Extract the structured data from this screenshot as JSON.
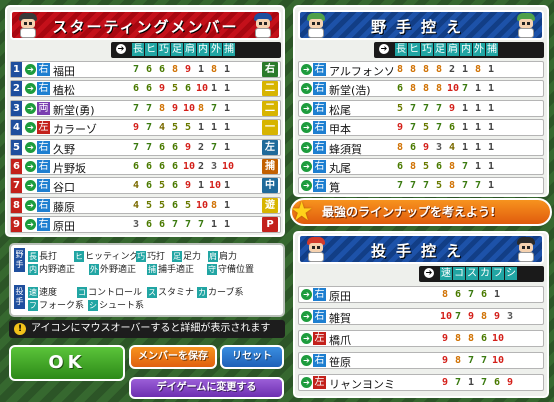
{
  "starting": {
    "title": "スターティングメンバー",
    "headers": [
      "長",
      "ヒ",
      "巧",
      "足",
      "肩",
      "内",
      "外",
      "捕"
    ],
    "rows": [
      {
        "num": "1",
        "hand": "右",
        "name": "福田",
        "stats": [
          "7",
          "6",
          "6",
          "8",
          "9",
          "1",
          "8",
          "1"
        ],
        "pos": "右"
      },
      {
        "num": "2",
        "hand": "右",
        "name": "植松",
        "stats": [
          "6",
          "6",
          "9",
          "5",
          "6",
          "10",
          "1",
          "1"
        ],
        "pos": "二"
      },
      {
        "num": "3",
        "hand": "両",
        "name": "新堂(勇)",
        "stats": [
          "7",
          "7",
          "8",
          "9",
          "10",
          "8",
          "7",
          "1"
        ],
        "pos": "二"
      },
      {
        "num": "4",
        "hand": "左",
        "name": "カラーゾ",
        "stats": [
          "9",
          "7",
          "4",
          "5",
          "5",
          "1",
          "1",
          "1"
        ],
        "pos": "一"
      },
      {
        "num": "5",
        "hand": "右",
        "name": "久野",
        "stats": [
          "7",
          "7",
          "6",
          "6",
          "9",
          "2",
          "7",
          "1"
        ],
        "pos": "左"
      },
      {
        "num": "6",
        "hand": "右",
        "name": "片野坂",
        "stats": [
          "6",
          "6",
          "6",
          "6",
          "10",
          "2",
          "3",
          "10"
        ],
        "pos": "捕"
      },
      {
        "num": "7",
        "hand": "右",
        "name": "谷口",
        "stats": [
          "4",
          "6",
          "5",
          "6",
          "9",
          "1",
          "10",
          "1"
        ],
        "pos": "中"
      },
      {
        "num": "8",
        "hand": "右",
        "name": "藤原",
        "stats": [
          "4",
          "5",
          "5",
          "6",
          "5",
          "10",
          "8",
          "1"
        ],
        "pos": "遊"
      },
      {
        "num": "9",
        "hand": "右",
        "name": "原田",
        "stats": [
          "3",
          "6",
          "6",
          "7",
          "7",
          "7",
          "1",
          "1"
        ],
        "pos": "P"
      }
    ]
  },
  "bench_fielders": {
    "title": "野手控え",
    "headers": [
      "長",
      "ヒ",
      "巧",
      "足",
      "肩",
      "内",
      "外",
      "捕"
    ],
    "rows": [
      {
        "hand": "右",
        "name": "アルフォンソ",
        "stats": [
          "8",
          "8",
          "8",
          "8",
          "2",
          "1",
          "8",
          "1"
        ]
      },
      {
        "hand": "右",
        "name": "新堂(浩)",
        "stats": [
          "6",
          "8",
          "8",
          "8",
          "10",
          "7",
          "1",
          "1"
        ]
      },
      {
        "hand": "右",
        "name": "松尾",
        "stats": [
          "5",
          "7",
          "7",
          "7",
          "9",
          "1",
          "1",
          "1"
        ]
      },
      {
        "hand": "右",
        "name": "甲本",
        "stats": [
          "9",
          "7",
          "5",
          "7",
          "6",
          "1",
          "1",
          "1"
        ]
      },
      {
        "hand": "右",
        "name": "蜂須賀",
        "stats": [
          "8",
          "6",
          "9",
          "3",
          "4",
          "1",
          "1",
          "1"
        ]
      },
      {
        "hand": "右",
        "name": "丸尾",
        "stats": [
          "6",
          "8",
          "5",
          "6",
          "8",
          "7",
          "1",
          "1"
        ]
      },
      {
        "hand": "右",
        "name": "筧",
        "stats": [
          "7",
          "7",
          "7",
          "5",
          "8",
          "7",
          "7",
          "1"
        ]
      }
    ]
  },
  "banner": "最強のラインナップを考えよう!",
  "bench_pitchers": {
    "title": "投手控え",
    "headers": [
      "速",
      "コ",
      "ス",
      "カ",
      "フ",
      "シ"
    ],
    "rows": [
      {
        "hand": "右",
        "name": "原田",
        "stats": [
          "8",
          "6",
          "7",
          "6",
          "1",
          ""
        ]
      },
      {
        "hand": "右",
        "name": "雑賀",
        "stats": [
          "10",
          "7",
          "9",
          "8",
          "9",
          "3"
        ]
      },
      {
        "hand": "左",
        "name": "橋爪",
        "stats": [
          "9",
          "8",
          "8",
          "6",
          "10",
          ""
        ]
      },
      {
        "hand": "右",
        "name": "笹原",
        "stats": [
          "9",
          "8",
          "7",
          "7",
          "10",
          ""
        ]
      },
      {
        "hand": "左",
        "name": "リャンヨンミ",
        "stats": [
          "9",
          "7",
          "1",
          "7",
          "6",
          "9"
        ]
      }
    ]
  },
  "legend": {
    "fielder_tag": "野手",
    "pitcher_tag": "投手",
    "fielder_items": [
      [
        "長",
        "長打"
      ],
      [
        "ヒ",
        "ヒッティング"
      ],
      [
        "巧",
        "巧打"
      ],
      [
        "足",
        "足力"
      ],
      [
        "肩",
        "肩力"
      ],
      [
        "内",
        "内野適正"
      ],
      [
        "外",
        "外野適正"
      ],
      [
        "捕",
        "捕手適正"
      ],
      [
        "守",
        "守備位置"
      ]
    ],
    "pitcher_items": [
      [
        "速",
        "速度"
      ],
      [
        "コ",
        "コントロール"
      ],
      [
        "ス",
        "スタミナ"
      ],
      [
        "カ",
        "カーブ系"
      ],
      [
        "フ",
        "フォーク系"
      ],
      [
        "シ",
        "シュート系"
      ]
    ]
  },
  "info": "アイコンにマウスオーバーすると詳細が表示されます",
  "buttons": {
    "ok": "OK",
    "save": "メンバーを保存",
    "reset": "リセット",
    "day_game": "デイゲームに変更する"
  }
}
